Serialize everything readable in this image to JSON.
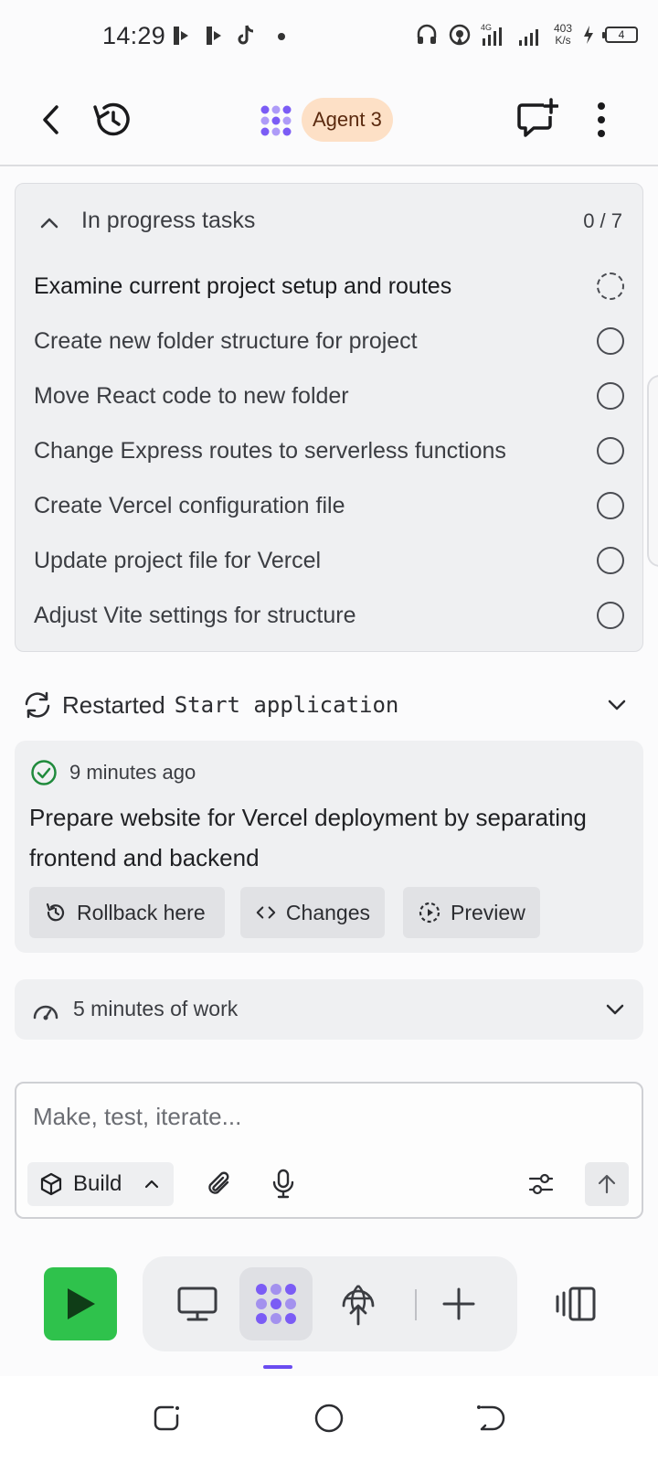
{
  "status_bar": {
    "time": "14:29",
    "net_speed_value": "403",
    "net_speed_unit": "K/s",
    "network_type": "4G",
    "battery": "4"
  },
  "header": {
    "agent_label": "Agent 3"
  },
  "tasks": {
    "title": "In progress tasks",
    "count": "0 / 7",
    "items": [
      {
        "label": "Examine current project setup and routes",
        "state": "in-progress"
      },
      {
        "label": "Create new folder structure for project",
        "state": "pending"
      },
      {
        "label": "Move React code to new folder",
        "state": "pending"
      },
      {
        "label": "Change Express routes to serverless functions",
        "state": "pending"
      },
      {
        "label": "Create Vercel configuration file",
        "state": "pending"
      },
      {
        "label": "Update project file for Vercel",
        "state": "pending"
      },
      {
        "label": "Adjust Vite settings for structure",
        "state": "pending"
      }
    ]
  },
  "restart": {
    "label": "Restarted",
    "code": "Start application"
  },
  "checkpoint": {
    "time": "9 minutes ago",
    "description": "Prepare website for Vercel deployment by separating frontend and backend",
    "rollback_label": "Rollback here",
    "changes_label": "Changes",
    "preview_label": "Preview"
  },
  "work": {
    "label": "5 minutes of work"
  },
  "composer": {
    "placeholder": "Make, test, iterate...",
    "mode_label": "Build"
  },
  "colors": {
    "accent": "#7b5cf5",
    "run_green": "#2fc24c",
    "agent_pill": "#fde0c6",
    "success": "#1f8a3c"
  },
  "icons": [
    "back-icon",
    "history-icon",
    "agent-logo-icon",
    "new-chat-icon",
    "more-icon",
    "chevron-up-icon",
    "refresh-icon",
    "chevron-down-icon",
    "check-circle-icon",
    "rollback-icon",
    "code-icon",
    "preview-icon",
    "gauge-icon",
    "cube-icon",
    "paperclip-icon",
    "microphone-icon",
    "sliders-icon",
    "arrow-up-icon",
    "play-icon",
    "monitor-icon",
    "globe-deploy-icon",
    "plus-icon",
    "panels-icon"
  ]
}
